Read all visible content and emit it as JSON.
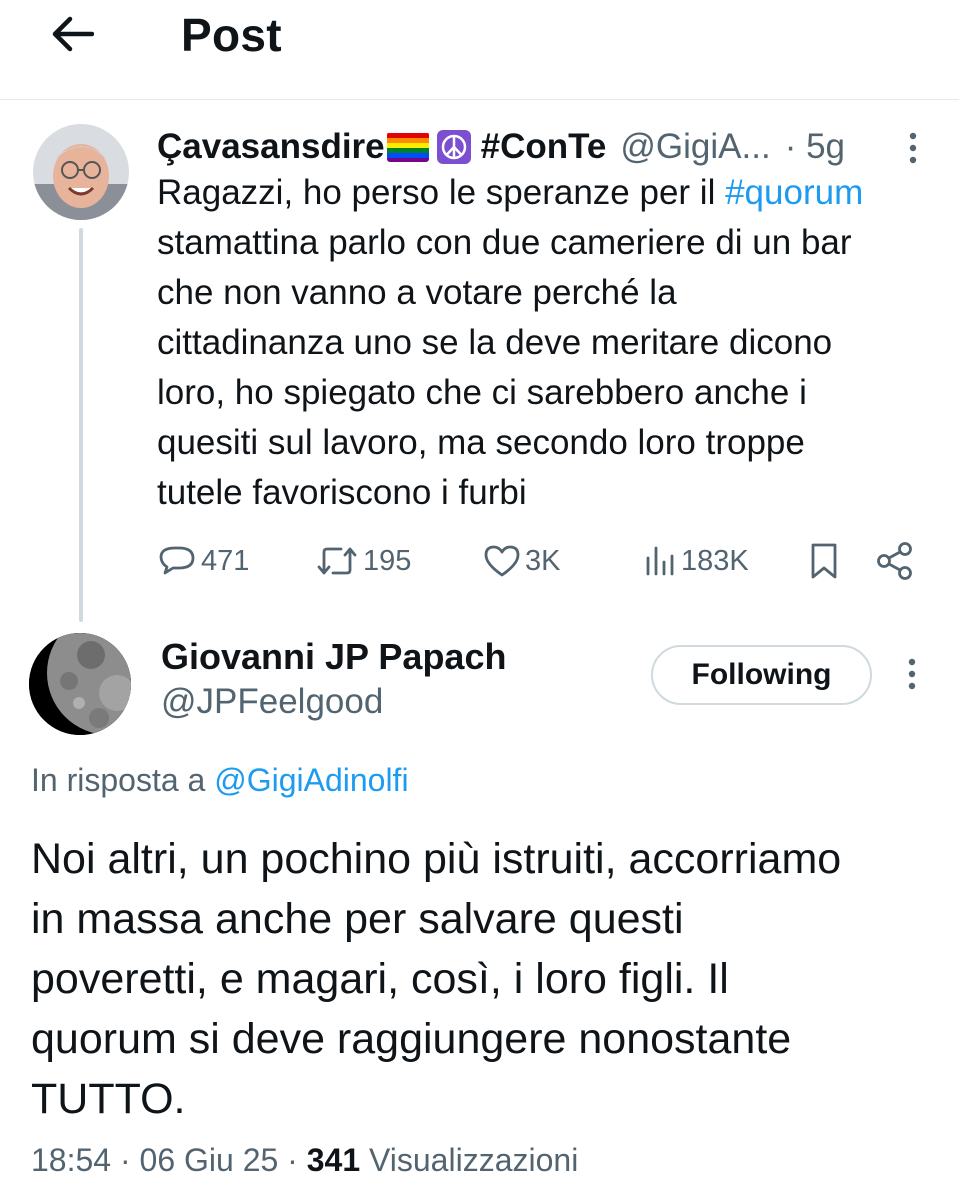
{
  "header": {
    "title": "Post"
  },
  "parent_tweet": {
    "display_name": "Çavasansdire",
    "display_name_suffix": "#ConTe",
    "handle": "@GigiA...",
    "separator": "·",
    "time": "5g",
    "text_lines": [
      [
        "Ragazzi, ho perso le speranze per il ",
        "#quorum"
      ],
      "stamattina parlo con due cameriere di un bar",
      "che non vanno a votare perché la",
      "cittadinanza uno se la deve meritare dicono",
      "loro, ho spiegato che ci sarebbero anche i",
      "quesiti sul lavoro, ma secondo loro troppe",
      "tutele favoriscono i furbi"
    ],
    "replies": "471",
    "reposts": "195",
    "likes": "3K",
    "views": "183K"
  },
  "main_tweet": {
    "display_name": "Giovanni JP Papach",
    "handle": "@JPFeelgood",
    "follow_label": "Following",
    "reply_prefix": "In risposta a ",
    "reply_mention": "@GigiAdinolfi",
    "text_lines": [
      "Noi altri, un pochino più istruiti, accorriamo",
      "in massa anche per salvare questi",
      "poveretti, e magari, così, i loro figli. Il",
      "quorum si deve raggiungere nonostante",
      "TUTTO."
    ],
    "time": "18:54",
    "date": "06 Giu 25",
    "separator": "·",
    "views_count": "341",
    "views_label": "Visualizzazioni"
  },
  "colors": {
    "text": "#0f1419",
    "secondary": "#536471",
    "link": "#1d9bf0",
    "border": "#cfd9de"
  },
  "icons": [
    "back-arrow-icon",
    "rainbow-flag-icon",
    "peace-symbol-icon",
    "more-icon",
    "reply-icon",
    "repost-icon",
    "like-icon",
    "views-icon",
    "bookmark-icon",
    "share-icon"
  ]
}
